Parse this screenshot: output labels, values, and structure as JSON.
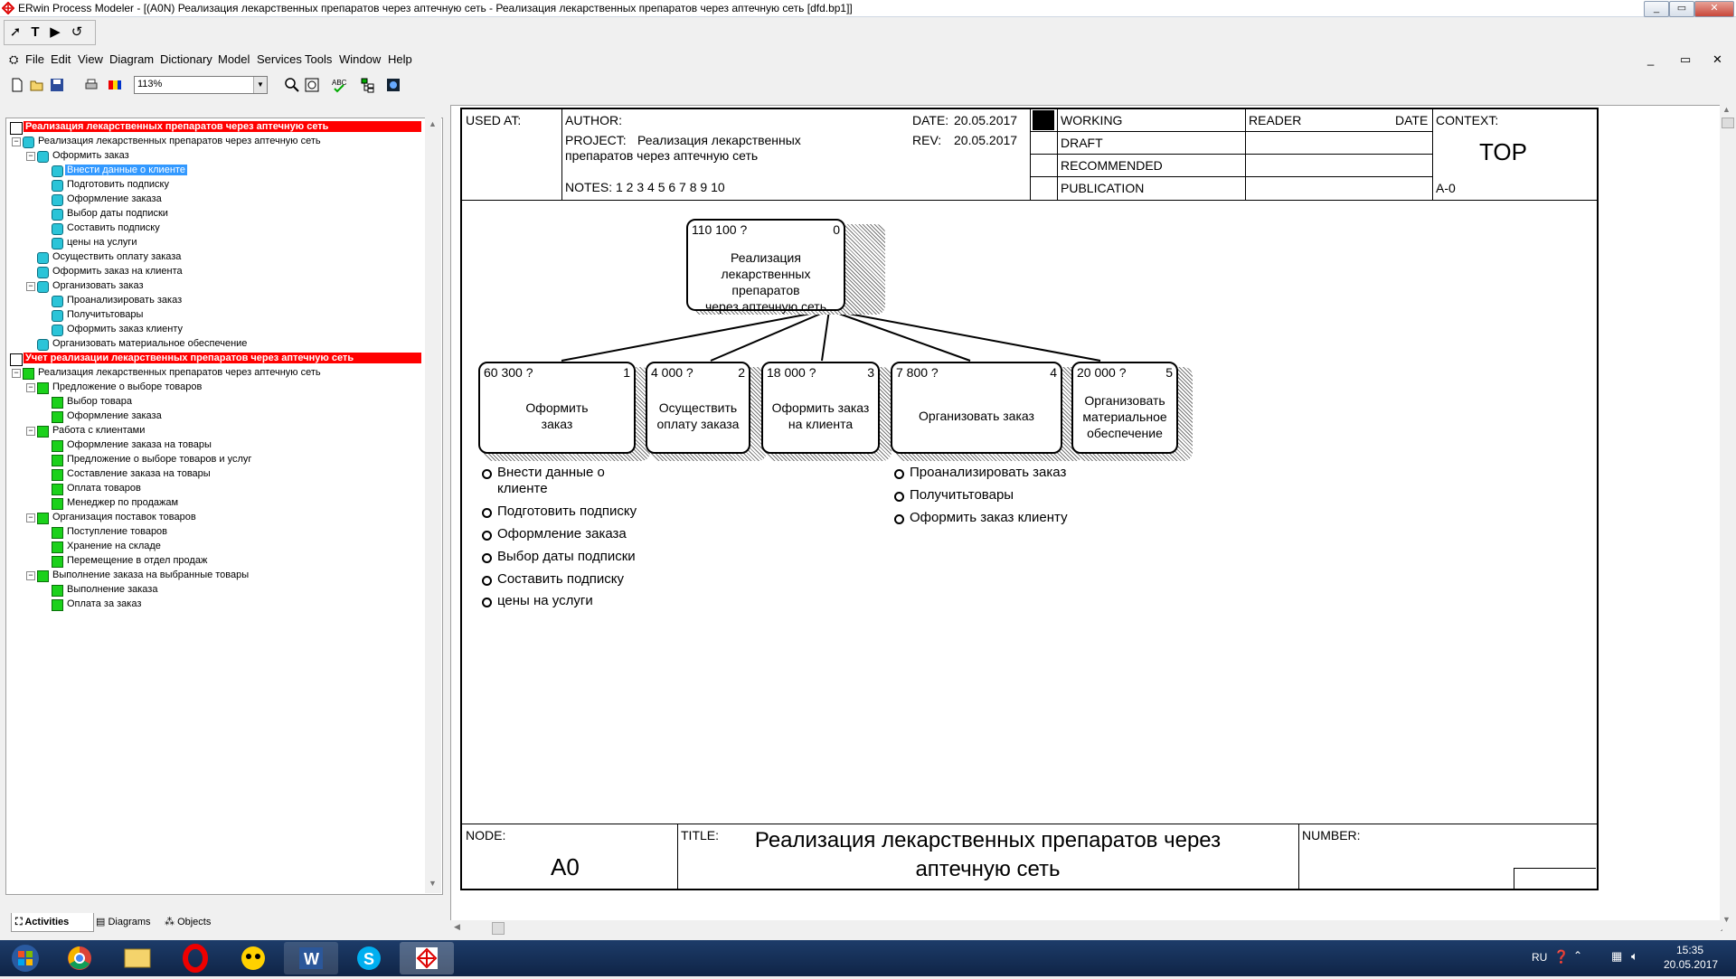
{
  "window": {
    "title": "ERwin Process Modeler - [(A0N) Реализация  лекарственных препаратов  через аптечную сеть - Реализация  лекарственных препаратов через аптечную сеть  [dfd.bp1]]",
    "buttons": [
      "_",
      "▭",
      "✕"
    ],
    "mdi_buttons": [
      "_",
      "▭",
      "✕"
    ]
  },
  "menu": [
    "File",
    "Edit",
    "View",
    "Diagram",
    "Dictionary",
    "Model",
    "Services",
    "Tools",
    "Window",
    "Help"
  ],
  "toolbar": {
    "zoom_value": "113%"
  },
  "tree": {
    "rows": [
      {
        "label": "Реализация  лекарственных препаратов через аптечную сеть",
        "level": 0,
        "kind": "root",
        "style": "red"
      },
      {
        "label": "Реализация  лекарственных препаратов  через аптечную сеть",
        "level": 1,
        "kind": "cyan"
      },
      {
        "label": "Оформить  заказ",
        "level": 2,
        "kind": "cyan"
      },
      {
        "label": "Внести данные  о клиенте",
        "level": 3,
        "kind": "cyan",
        "style": "sel"
      },
      {
        "label": "Подготовить подписку",
        "level": 3,
        "kind": "cyan"
      },
      {
        "label": "Оформление заказа",
        "level": 3,
        "kind": "cyan"
      },
      {
        "label": "Выбор даты  подписки",
        "level": 3,
        "kind": "cyan"
      },
      {
        "label": "Составить подписку",
        "level": 3,
        "kind": "cyan"
      },
      {
        "label": "цены на услуги",
        "level": 3,
        "kind": "cyan"
      },
      {
        "label": "Осуществить оплату заказа",
        "level": 2,
        "kind": "cyan"
      },
      {
        "label": "Оформить заказ на клиента",
        "level": 2,
        "kind": "cyan"
      },
      {
        "label": "Организовать заказ",
        "level": 2,
        "kind": "cyan"
      },
      {
        "label": "Проанализировать заказ",
        "level": 3,
        "kind": "cyan"
      },
      {
        "label": "Получитьтовары",
        "level": 3,
        "kind": "cyan"
      },
      {
        "label": "Оформить заказ клиенту",
        "level": 3,
        "kind": "cyan"
      },
      {
        "label": "Организовать материальное обеспечение",
        "level": 2,
        "kind": "cyan"
      },
      {
        "label": "Учет реализации лекарственных препаратов через аптечную сеть",
        "level": 0,
        "kind": "root",
        "style": "red"
      },
      {
        "label": "Реализация  лекарственных препаратов  через аптечную сеть",
        "level": 1,
        "kind": "green"
      },
      {
        "label": "Предложение о выборе товаров",
        "level": 2,
        "kind": "green"
      },
      {
        "label": "Выбор товара",
        "level": 3,
        "kind": "green"
      },
      {
        "label": "Оформление заказа",
        "level": 3,
        "kind": "green"
      },
      {
        "label": "Работа с клиентами",
        "level": 2,
        "kind": "green"
      },
      {
        "label": "Оформление  заказа на товары",
        "level": 3,
        "kind": "green"
      },
      {
        "label": "Предложение о выборе  товаров и услуг",
        "level": 3,
        "kind": "green"
      },
      {
        "label": "Составление заказа  на товары",
        "level": 3,
        "kind": "green"
      },
      {
        "label": "Оплата товаров",
        "level": 3,
        "kind": "green"
      },
      {
        "label": "Менеджер по продажам",
        "level": 3,
        "kind": "green"
      },
      {
        "label": "Организация поставок товаров",
        "level": 2,
        "kind": "green"
      },
      {
        "label": "Поступление товаров",
        "level": 3,
        "kind": "green"
      },
      {
        "label": "Хранение на складе",
        "level": 3,
        "kind": "green"
      },
      {
        "label": "Перемещение в  отдел продаж",
        "level": 3,
        "kind": "green"
      },
      {
        "label": "Выполнение заказа  на выбранные товары",
        "level": 2,
        "kind": "green"
      },
      {
        "label": "Выполнение заказа",
        "level": 3,
        "kind": "green"
      },
      {
        "label": "Оплата за заказ",
        "level": 3,
        "kind": "green"
      }
    ]
  },
  "tabs": [
    "Activities",
    "Diagrams",
    "Objects"
  ],
  "frame": {
    "used_at": "USED AT:",
    "author": "AUTHOR:",
    "project_label": "PROJECT:",
    "project_value": "Реализация лекарственных",
    "project_value2": "препаратов через аптечную сеть",
    "date_label": "DATE:",
    "date_value": "20.05.2017",
    "rev_label": "REV:",
    "rev_value": "20.05.2017",
    "notes": "NOTES:  1  2  3  4  5  6  7  8  9  10",
    "status": [
      "WORKING",
      "DRAFT",
      "RECOMMENDED",
      "PUBLICATION"
    ],
    "reader": "READER",
    "date2": "DATE",
    "context": "CONTEXT:",
    "top": "TOP",
    "node_ref": "A-0",
    "node_label": "NODE:",
    "node_value": "A0",
    "title_label": "TITLE:",
    "title_value_1": "Реализация  лекарственных препаратов  через",
    "title_value_2": "аптечную сеть",
    "number_label": "NUMBER:"
  },
  "diagram": {
    "root": {
      "cost": "110 100 ?",
      "num": "0",
      "text": [
        "Реализация",
        "лекарственных препаратов",
        "через аптечную сеть"
      ]
    },
    "children": [
      {
        "cost": "60 300 ?",
        "num": "1",
        "text": [
          "Оформить",
          "заказ"
        ]
      },
      {
        "cost": "4 000 ?",
        "num": "2",
        "text": [
          "Осуществить",
          "оплату заказа"
        ]
      },
      {
        "cost": "18 000 ?",
        "num": "3",
        "text": [
          "Оформить заказ",
          "на клиента"
        ]
      },
      {
        "cost": "7 800 ?",
        "num": "4",
        "text": [
          "Организовать заказ"
        ]
      },
      {
        "cost": "20 000 ?",
        "num": "5",
        "text": [
          "Организовать",
          "материальное",
          "обеспечение"
        ]
      }
    ],
    "list1": [
      "Внести данные  о",
      "клиенте",
      "Подготовить подписку",
      "Оформление заказа",
      "Выбор даты  подписки",
      "Составить подписку",
      "цены на услуги"
    ],
    "list2": [
      "Проанализировать заказ",
      "Получитьтовары",
      "Оформить заказ клиенту"
    ]
  },
  "tray": {
    "lang": "RU",
    "time": "15:35",
    "date": "20.05.2017"
  }
}
